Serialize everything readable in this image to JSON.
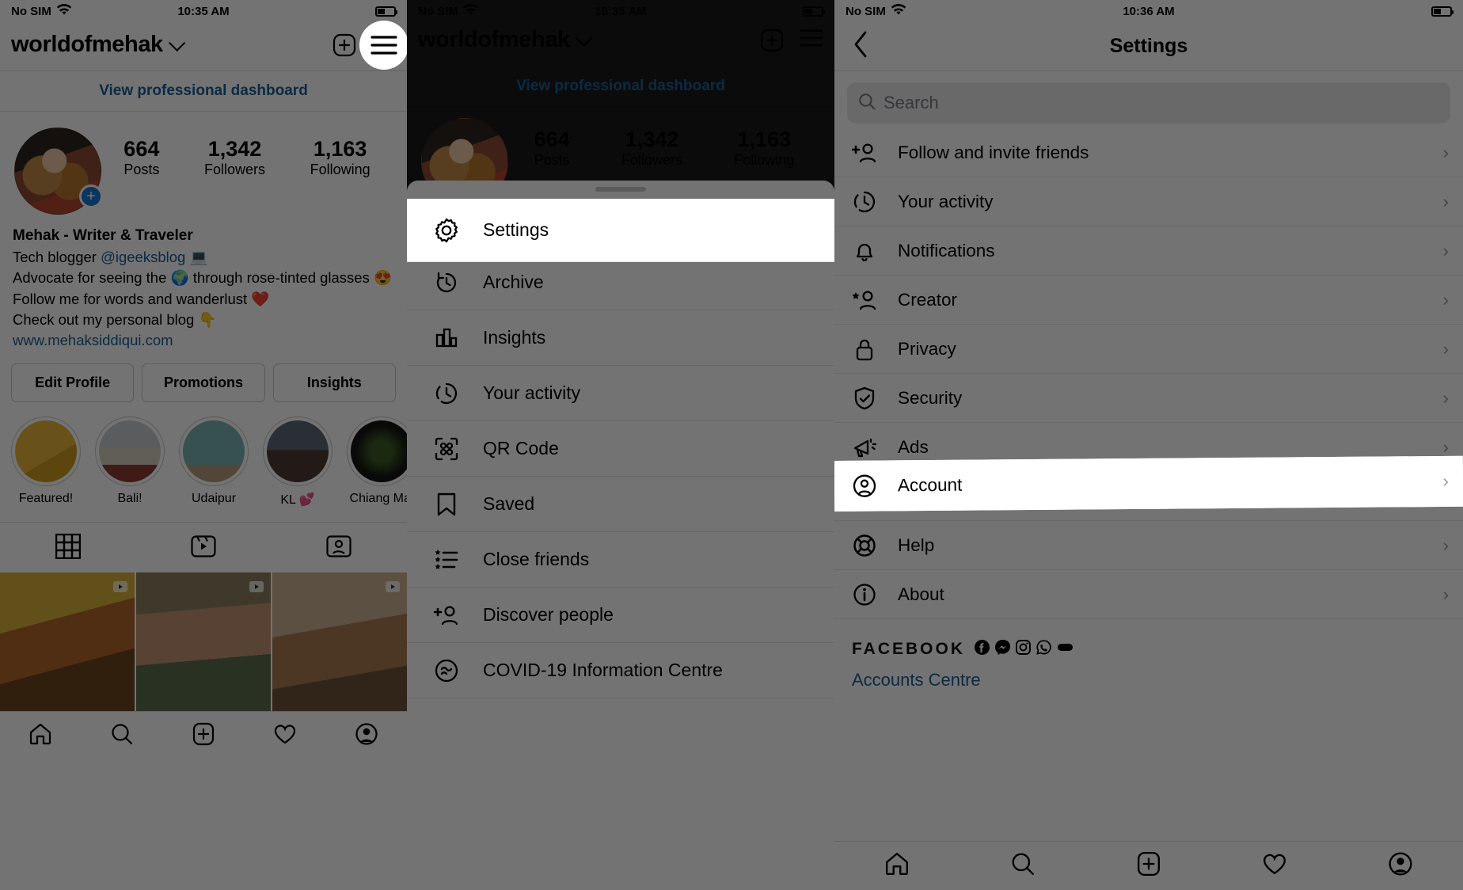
{
  "panel1": {
    "status": {
      "carrier": "No SIM",
      "time": "10:35 AM",
      "wifi_icon": "wifi-icon",
      "battery_icon": "battery-icon"
    },
    "header": {
      "username": "worldofmehak",
      "chevron_icon": "chevron-down-icon",
      "add_icon": "plus-square-icon",
      "menu_icon": "hamburger-menu-icon"
    },
    "professional_dashboard": "View professional dashboard",
    "avatar": {
      "name": "avatar",
      "add_badge": "+"
    },
    "stats": [
      {
        "num": "664",
        "label": "Posts"
      },
      {
        "num": "1,342",
        "label": "Followers"
      },
      {
        "num": "1,163",
        "label": "Following"
      }
    ],
    "bio": {
      "name": "Mehak - Writer & Traveler",
      "line1_pre": "Tech blogger ",
      "line1_handle": "@igeeksblog",
      "line1_post": " 💻",
      "line2": "Advocate for seeing the 🌍 through rose-tinted glasses 😍",
      "line3": "Follow me for words and wanderlust ❤️",
      "line4": "Check out my personal blog 👇",
      "website": "www.mehaksiddiqui.com"
    },
    "actions": [
      "Edit Profile",
      "Promotions",
      "Insights"
    ],
    "highlights": [
      {
        "label": "Featured!"
      },
      {
        "label": "Bali!"
      },
      {
        "label": "Udaipur"
      },
      {
        "label": "KL 💕"
      },
      {
        "label": "Chiang Mai"
      }
    ],
    "tabs": [
      {
        "icon": "grid-icon",
        "active": true
      },
      {
        "icon": "reels-icon",
        "active": false
      },
      {
        "icon": "tagged-icon",
        "active": false
      }
    ],
    "bottom_nav": [
      "home-icon",
      "search-icon",
      "add-post-icon",
      "heart-icon",
      "profile-icon"
    ]
  },
  "panel2": {
    "status": {
      "carrier": "No SIM",
      "time": "10:35 AM",
      "wifi_icon": "wifi-icon",
      "battery_icon": "battery-icon"
    },
    "header": {
      "username": "worldofmehak",
      "chevron_icon": "chevron-down-icon",
      "add_icon": "plus-square-icon",
      "menu_icon": "hamburger-menu-icon"
    },
    "professional_dashboard": "View professional dashboard",
    "stats": [
      {
        "num": "664",
        "label": "Posts"
      },
      {
        "num": "1,342",
        "label": "Followers"
      },
      {
        "num": "1,163",
        "label": "Following"
      }
    ],
    "sheet_items": [
      {
        "label": "Settings",
        "icon": "gear-icon",
        "highlighted": true
      },
      {
        "label": "Archive",
        "icon": "archive-clock-icon",
        "highlighted": false
      },
      {
        "label": "Insights",
        "icon": "insights-bar-icon",
        "highlighted": false
      },
      {
        "label": "Your activity",
        "icon": "activity-clock-icon",
        "highlighted": false
      },
      {
        "label": "QR Code",
        "icon": "qr-code-icon",
        "highlighted": false
      },
      {
        "label": "Saved",
        "icon": "bookmark-icon",
        "highlighted": false
      },
      {
        "label": "Close friends",
        "icon": "close-friends-list-icon",
        "highlighted": false
      },
      {
        "label": "Discover people",
        "icon": "add-person-icon",
        "highlighted": false
      },
      {
        "label": "COVID-19 Information Centre",
        "icon": "covid-shield-icon",
        "highlighted": false
      }
    ]
  },
  "panel3": {
    "status": {
      "carrier": "No SIM",
      "time": "10:36 AM",
      "wifi_icon": "wifi-icon",
      "battery_icon": "battery-icon"
    },
    "nav": {
      "back_icon": "back-chevron-icon",
      "title": "Settings"
    },
    "search": {
      "placeholder": "Search",
      "value": "",
      "icon": "search-icon"
    },
    "items": [
      {
        "label": "Follow and invite friends",
        "icon": "add-person-icon",
        "chevron": "›",
        "highlighted": false
      },
      {
        "label": "Your activity",
        "icon": "activity-clock-icon",
        "chevron": "›",
        "highlighted": false
      },
      {
        "label": "Notifications",
        "icon": "bell-icon",
        "chevron": "›",
        "highlighted": false
      },
      {
        "label": "Creator",
        "icon": "creator-star-person-icon",
        "chevron": "›",
        "highlighted": false
      },
      {
        "label": "Privacy",
        "icon": "lock-icon",
        "chevron": "›",
        "highlighted": false
      },
      {
        "label": "Security",
        "icon": "shield-check-icon",
        "chevron": "›",
        "highlighted": false
      },
      {
        "label": "Ads",
        "icon": "megaphone-icon",
        "chevron": "›",
        "highlighted": false
      },
      {
        "label": "Account",
        "icon": "account-circle-icon",
        "chevron": "›",
        "highlighted": true
      },
      {
        "label": "Help",
        "icon": "life-ring-icon",
        "chevron": "›",
        "highlighted": false
      },
      {
        "label": "About",
        "icon": "info-circle-icon",
        "chevron": "›",
        "highlighted": false
      }
    ],
    "facebook": {
      "label": "FACEBOOK",
      "icons": [
        "facebook-icon",
        "messenger-icon",
        "instagram-icon",
        "whatsapp-icon",
        "portal-icon"
      ],
      "accounts_centre": "Accounts Centre"
    },
    "bottom_nav": [
      "home-icon",
      "search-icon",
      "add-post-icon",
      "heart-icon",
      "profile-icon"
    ]
  },
  "colors": {
    "link_blue": "#1b5e96",
    "badge_blue": "#1877d2",
    "dim_overlay": "rgba(0,0,0,0.55)",
    "text_black": "#000000"
  }
}
